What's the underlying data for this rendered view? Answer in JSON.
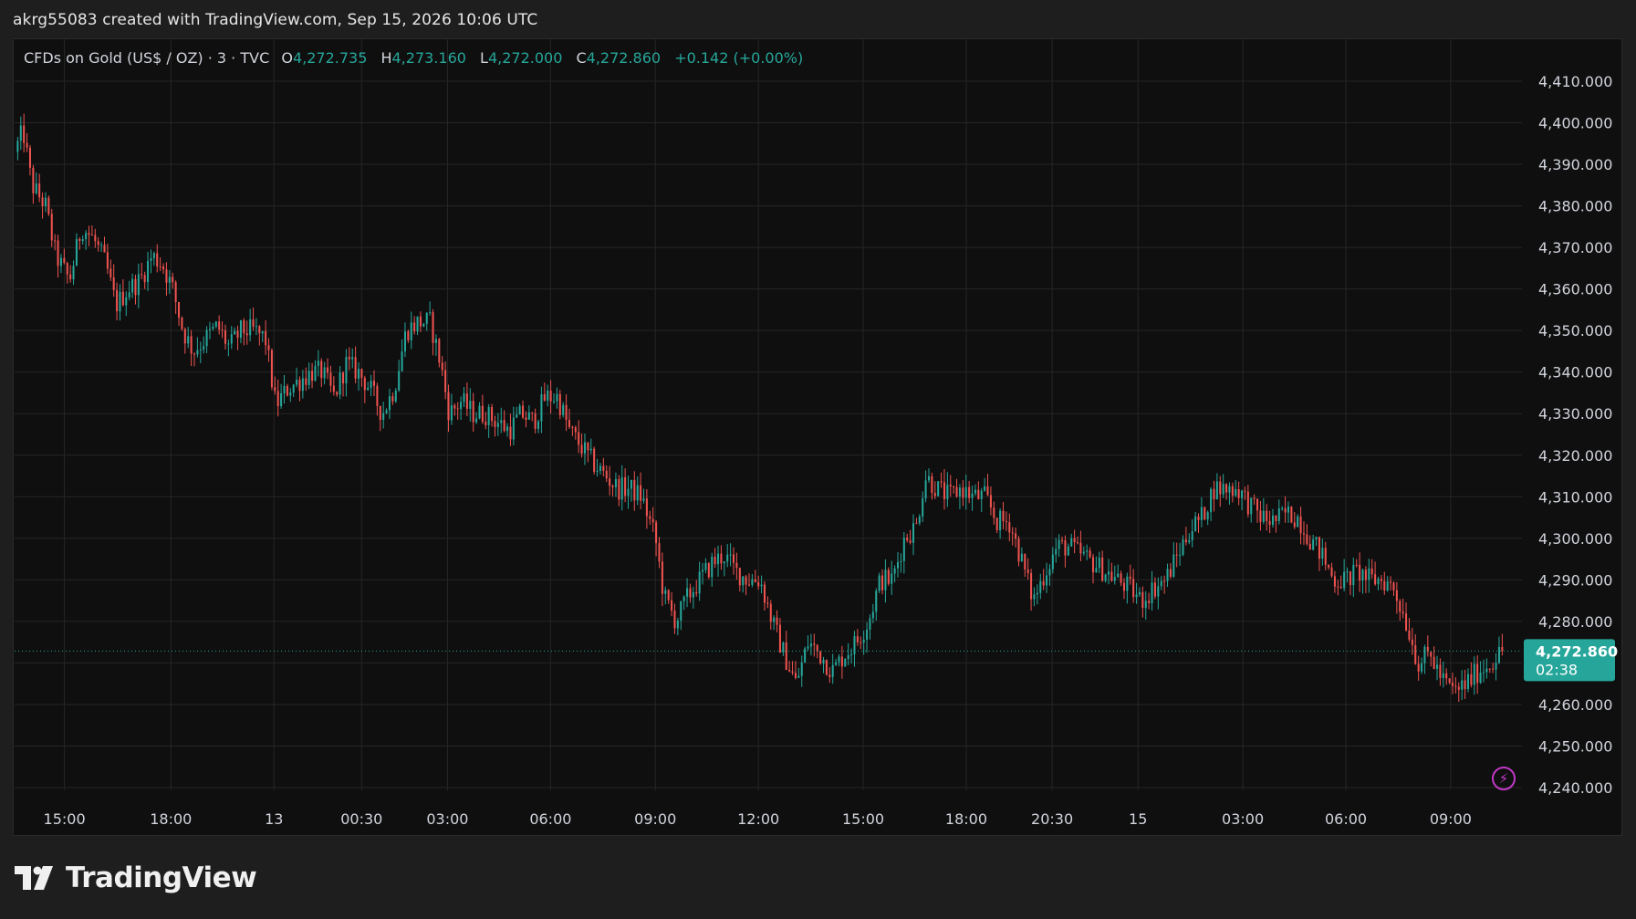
{
  "header": {
    "attribution": "akrg55083 created with TradingView.com, Sep 15, 2026 10:06 UTC"
  },
  "legend": {
    "symbol": "CFDs on Gold (US$ / OZ) · 3 · TVC",
    "open_label": "O",
    "open": "4,272.735",
    "high_label": "H",
    "high": "4,273.160",
    "low_label": "L",
    "low": "4,272.000",
    "close_label": "C",
    "close": "4,272.860",
    "change": "+0.142 (+0.00%)"
  },
  "price_tag": {
    "price": "4,272.860",
    "countdown": "02:38"
  },
  "footer": {
    "brand": "TradingView"
  },
  "colors": {
    "up": "#26a69a",
    "down": "#ef5350",
    "grid": "#262626",
    "axis_text": "#d1d4dc",
    "background": "#0f0f0f"
  },
  "icons": {
    "brand_logo": "tradingview-logo-icon",
    "alert": "lightning-icon"
  },
  "chart_data": {
    "type": "candlestick",
    "ylim": [
      4235,
      4415
    ],
    "y_ticks": [
      {
        "value": 4410,
        "label": "4,410.000"
      },
      {
        "value": 4400,
        "label": "4,400.000"
      },
      {
        "value": 4390,
        "label": "4,390.000"
      },
      {
        "value": 4380,
        "label": "4,380.000"
      },
      {
        "value": 4370,
        "label": "4,370.000"
      },
      {
        "value": 4360,
        "label": "4,360.000"
      },
      {
        "value": 4350,
        "label": "4,350.000"
      },
      {
        "value": 4340,
        "label": "4,340.000"
      },
      {
        "value": 4330,
        "label": "4,330.000"
      },
      {
        "value": 4320,
        "label": "4,320.000"
      },
      {
        "value": 4310,
        "label": "4,310.000"
      },
      {
        "value": 4300,
        "label": "4,300.000"
      },
      {
        "value": 4290,
        "label": "4,290.000"
      },
      {
        "value": 4280,
        "label": "4,280.000"
      },
      {
        "value": 4260,
        "label": "4,260.000"
      },
      {
        "value": 4250,
        "label": "4,250.000"
      },
      {
        "value": 4240,
        "label": "4,240.000"
      }
    ],
    "x_ticks": [
      {
        "t": 2.9,
        "label": "15:00"
      },
      {
        "t": 9.1,
        "label": "18:00"
      },
      {
        "t": 15.1,
        "label": "13"
      },
      {
        "t": 20.2,
        "label": "00:30"
      },
      {
        "t": 25.2,
        "label": "03:00"
      },
      {
        "t": 31.2,
        "label": "06:00"
      },
      {
        "t": 37.3,
        "label": "09:00"
      },
      {
        "t": 43.3,
        "label": "12:00"
      },
      {
        "t": 49.4,
        "label": "15:00"
      },
      {
        "t": 55.4,
        "label": "18:00"
      },
      {
        "t": 60.4,
        "label": "20:30"
      },
      {
        "t": 65.4,
        "label": "15"
      },
      {
        "t": 71.5,
        "label": "03:00"
      },
      {
        "t": 77.5,
        "label": "06:00"
      },
      {
        "t": 83.6,
        "label": "09:00"
      }
    ],
    "t_range": [
      0,
      86.9
    ],
    "last_price": 4272.86,
    "path": [
      [
        0,
        4393
      ],
      [
        0.5,
        4398
      ],
      [
        1.0,
        4385
      ],
      [
        1.8,
        4380
      ],
      [
        2.4,
        4368
      ],
      [
        3.2,
        4362
      ],
      [
        3.9,
        4375
      ],
      [
        4.6,
        4372
      ],
      [
        5.3,
        4366
      ],
      [
        5.9,
        4356
      ],
      [
        6.6,
        4360
      ],
      [
        7.3,
        4362
      ],
      [
        8.0,
        4368
      ],
      [
        8.6,
        4366
      ],
      [
        9.2,
        4360
      ],
      [
        9.8,
        4350
      ],
      [
        10.4,
        4345
      ],
      [
        11.1,
        4348
      ],
      [
        11.8,
        4351
      ],
      [
        12.5,
        4346
      ],
      [
        13.2,
        4350
      ],
      [
        13.9,
        4350
      ],
      [
        14.6,
        4348
      ],
      [
        15.2,
        4332
      ],
      [
        15.9,
        4336
      ],
      [
        16.6,
        4338
      ],
      [
        17.3,
        4340
      ],
      [
        17.9,
        4340
      ],
      [
        18.6,
        4334
      ],
      [
        19.3,
        4342
      ],
      [
        20.0,
        4340
      ],
      [
        20.7,
        4336
      ],
      [
        21.4,
        4330
      ],
      [
        22.1,
        4336
      ],
      [
        22.8,
        4350
      ],
      [
        23.5,
        4352
      ],
      [
        24.2,
        4352
      ],
      [
        24.8,
        4342
      ],
      [
        25.3,
        4330
      ],
      [
        26.0,
        4333
      ],
      [
        26.7,
        4330
      ],
      [
        27.4,
        4330
      ],
      [
        28.1,
        4328
      ],
      [
        28.8,
        4326
      ],
      [
        29.5,
        4330
      ],
      [
        30.2,
        4328
      ],
      [
        30.9,
        4334
      ],
      [
        31.6,
        4334
      ],
      [
        32.3,
        4326
      ],
      [
        33.0,
        4322
      ],
      [
        33.7,
        4318
      ],
      [
        34.4,
        4315
      ],
      [
        35.1,
        4312
      ],
      [
        35.8,
        4312
      ],
      [
        36.5,
        4310
      ],
      [
        37.3,
        4300
      ],
      [
        37.8,
        4286
      ],
      [
        38.5,
        4280
      ],
      [
        39.2,
        4286
      ],
      [
        39.9,
        4290
      ],
      [
        40.6,
        4294
      ],
      [
        41.3,
        4296
      ],
      [
        42.0,
        4292
      ],
      [
        42.7,
        4290
      ],
      [
        43.4,
        4290
      ],
      [
        44.1,
        4280
      ],
      [
        44.8,
        4272
      ],
      [
        45.5,
        4265
      ],
      [
        46.2,
        4275
      ],
      [
        46.9,
        4272
      ],
      [
        47.6,
        4268
      ],
      [
        48.3,
        4272
      ],
      [
        49.0,
        4275
      ],
      [
        49.7,
        4280
      ],
      [
        50.4,
        4290
      ],
      [
        51.1,
        4290
      ],
      [
        51.8,
        4300
      ],
      [
        52.5,
        4303
      ],
      [
        53.0,
        4315
      ],
      [
        53.7,
        4312
      ],
      [
        54.4,
        4310
      ],
      [
        55.1,
        4312
      ],
      [
        55.8,
        4310
      ],
      [
        56.5,
        4310
      ],
      [
        57.2,
        4304
      ],
      [
        57.9,
        4304
      ],
      [
        58.6,
        4295
      ],
      [
        59.3,
        4285
      ],
      [
        60.0,
        4292
      ],
      [
        60.7,
        4298
      ],
      [
        61.4,
        4298
      ],
      [
        62.1,
        4296
      ],
      [
        62.8,
        4294
      ],
      [
        63.5,
        4292
      ],
      [
        64.2,
        4290
      ],
      [
        64.9,
        4288
      ],
      [
        65.6,
        4285
      ],
      [
        66.3,
        4288
      ],
      [
        67.0,
        4290
      ],
      [
        67.7,
        4296
      ],
      [
        68.4,
        4302
      ],
      [
        69.1,
        4305
      ],
      [
        69.8,
        4312
      ],
      [
        70.5,
        4312
      ],
      [
        71.2,
        4312
      ],
      [
        71.9,
        4308
      ],
      [
        72.6,
        4305
      ],
      [
        73.3,
        4304
      ],
      [
        74.0,
        4306
      ],
      [
        74.7,
        4305
      ],
      [
        75.4,
        4300
      ],
      [
        76.1,
        4296
      ],
      [
        76.8,
        4290
      ],
      [
        77.5,
        4290
      ],
      [
        78.2,
        4292
      ],
      [
        78.9,
        4290
      ],
      [
        79.6,
        4290
      ],
      [
        80.3,
        4288
      ],
      [
        81.0,
        4280
      ],
      [
        81.7,
        4270
      ],
      [
        82.4,
        4272
      ],
      [
        83.1,
        4266
      ],
      [
        83.8,
        4263
      ],
      [
        84.5,
        4265
      ],
      [
        85.2,
        4268
      ],
      [
        85.9,
        4270
      ],
      [
        86.6,
        4272.86
      ]
    ]
  }
}
